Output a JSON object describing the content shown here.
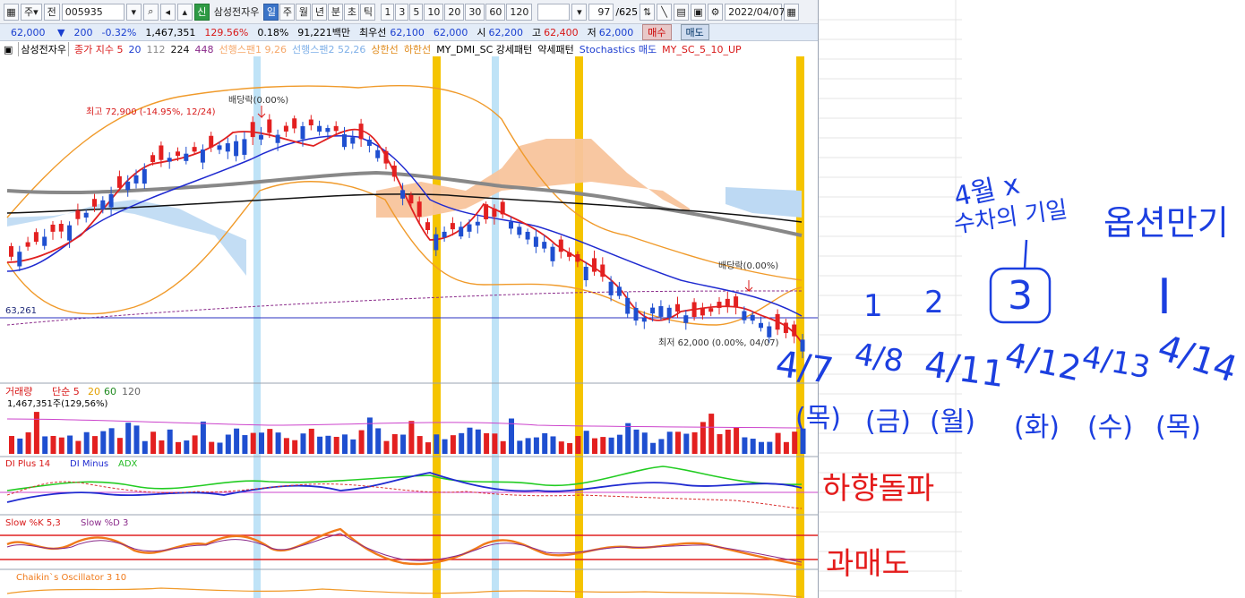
{
  "toolbar": {
    "period": "주",
    "type": "전",
    "code": "005935",
    "stock_name": "삼성전자우",
    "badge": "신",
    "tabs": [
      "일",
      "주",
      "월",
      "년",
      "분",
      "초",
      "틱"
    ],
    "intervals": [
      "1",
      "3",
      "5",
      "10",
      "20",
      "30",
      "60",
      "120"
    ],
    "count": "97",
    "total": "/625",
    "date": "2022/04/07"
  },
  "quote": {
    "price": "62,000",
    "change": "200",
    "pct": "-0.32%",
    "volume": "1,467,351",
    "vol_ratio": "129.56%",
    "turnover": "0.18%",
    "amount": "91,221백만",
    "ask_label": "최우선",
    "ask1": "62,100",
    "ask2": "62,000",
    "open_label": "시",
    "open": "62,200",
    "high_label": "고",
    "high": "62,400",
    "low_label": "저",
    "low": "62,000",
    "buy": "매수",
    "sell": "매도"
  },
  "legend": {
    "name": "삼성전자우",
    "ma_label": "종가 지수 5",
    "ma20": "20",
    "ma112": "112",
    "ma224": "224",
    "ma448": "448",
    "span1": "선행스팬1 9,26",
    "span2": "선행스팬2 52,26",
    "upper": "상한선",
    "lower": "하한선",
    "dmi": "MY_DMI_SC 강세패턴",
    "weak": "약세패턴",
    "stoch": "Stochastics 매도",
    "mysc": "MY_SC_5_10_UP"
  },
  "annotations": {
    "dividend1": "배당락(0.00%)",
    "dividend2": "배당락(0.00%)",
    "high": "최고 72,900 (-14.95%, 12/24)",
    "low": "최저 62,000 (0.00%, 04/07)",
    "price_line": "63,261"
  },
  "volume_panel": {
    "title": "거래량",
    "ma": "단순 5",
    "m20": "20",
    "m60": "60",
    "m120": "120",
    "value": "1,467,351주(129,56%)"
  },
  "dmi_panel": {
    "plus": "DI Plus 14",
    "minus": "DI Minus",
    "adx": "ADX"
  },
  "stoch_panel": {
    "k": "Slow %K 5,3",
    "d": "Slow %D 3"
  },
  "chaikin_panel": {
    "label": "Chaikin`s Oscillator 3 10"
  },
  "handwritten": {
    "top_left": "4월 x",
    "top_left2": "수차의 기일",
    "top_right": "옵션만기",
    "n1": "1",
    "n2": "2",
    "n3": "3",
    "roman": "I",
    "d1": "4/7",
    "d2": "4/8",
    "d3": "4/11",
    "d4": "4/12",
    "d5": "4/13",
    "d6": "4/14",
    "w1": "(목)",
    "w2": "(금)",
    "w3": "(월)",
    "w4": "(화)",
    "w5": "(수)",
    "w6": "(목)",
    "dmi_note": "하향돌파",
    "stoch_note": "과매도"
  },
  "colors": {
    "rise": "#e32020",
    "fall": "#1f4fd0",
    "highlight": "#f5c400",
    "sky": "#bfe3f7",
    "pen_blue": "#1c3fe0",
    "pen_red": "#e41b1b"
  }
}
